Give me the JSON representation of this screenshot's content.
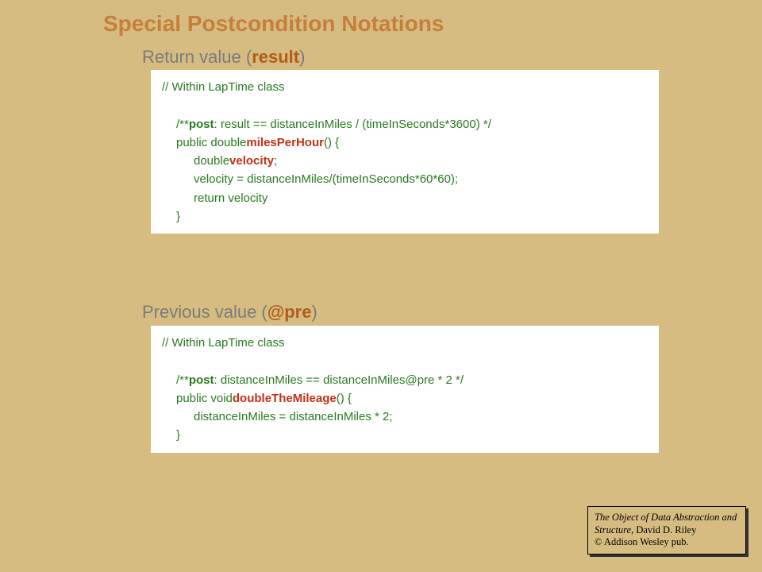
{
  "title": "Special Postcondition Notations",
  "section1": {
    "heading_pre": "Return value (",
    "heading_em": "result",
    "heading_post": ")",
    "code": {
      "l1": "// Within LapTime class",
      "l2a": "/** ",
      "l2b": "post",
      "l2c": ": result == distanceInMiles / (timeInSeconds*3600) */",
      "l3a": "public double ",
      "l3b": "milesPerHour",
      "l3c": "()   {",
      "l4a": "double ",
      "l4b": "velocity",
      "l4c": ";",
      "l5": "velocity = distanceInMiles/(timeInSeconds*60*60);",
      "l6": "return velocity",
      "l7": "}"
    }
  },
  "section2": {
    "heading_pre": "Previous value (",
    "heading_em": "@pre",
    "heading_post": ")",
    "code": {
      "l1": "// Within LapTime class",
      "l2a": "/** ",
      "l2b": "post",
      "l2c": ": distanceInMiles == distanceInMiles@pre * 2 */",
      "l3a": "public void ",
      "l3b": "doubleTheMileage",
      "l3c": "() {",
      "l4": "distanceInMiles = distanceInMiles * 2;",
      "l5": "}"
    }
  },
  "credit": {
    "line1": "The Object of Data Abstraction and Structure",
    "line2": ", David D. Riley",
    "line3": "© Addison Wesley pub."
  }
}
